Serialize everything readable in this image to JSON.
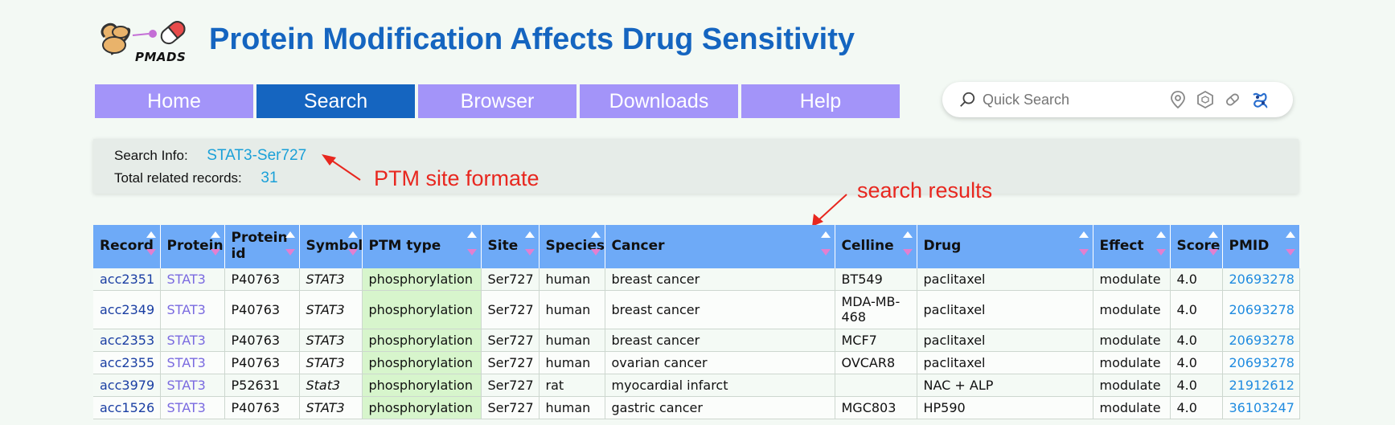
{
  "site": {
    "logo_text": "PMADS",
    "title": "Protein Modification Affects Drug Sensitivity"
  },
  "nav": [
    {
      "label": "Home",
      "active": false
    },
    {
      "label": "Search",
      "active": true
    },
    {
      "label": "Browser",
      "active": false
    },
    {
      "label": "Downloads",
      "active": false
    },
    {
      "label": "Help",
      "active": false
    }
  ],
  "quick_search": {
    "placeholder": "Quick Search",
    "icons": [
      "search-icon",
      "location-pin-icon",
      "hexagon-icon",
      "pill-icon",
      "protein-structure-icon"
    ]
  },
  "search_info": {
    "label": "Search Info:",
    "value": "STAT3-Ser727",
    "total_label": "Total related records:",
    "total_value": "31"
  },
  "annotations": {
    "ptm": "PTM site formate",
    "results": "search results"
  },
  "table": {
    "columns": [
      "Record",
      "Protein",
      "Protein id",
      "Symbol",
      "PTM type",
      "Site",
      "Species",
      "Cancer",
      "Celline",
      "Drug",
      "Effect",
      "Score",
      "PMID"
    ],
    "rows": [
      [
        "acc2351",
        "STAT3",
        "P40763",
        "STAT3",
        "phosphorylation",
        "Ser727",
        "human",
        "breast cancer",
        "BT549",
        "paclitaxel",
        "modulate",
        "4.0",
        "20693278"
      ],
      [
        "acc2349",
        "STAT3",
        "P40763",
        "STAT3",
        "phosphorylation",
        "Ser727",
        "human",
        "breast cancer",
        "MDA-MB-468",
        "paclitaxel",
        "modulate",
        "4.0",
        "20693278"
      ],
      [
        "acc2353",
        "STAT3",
        "P40763",
        "STAT3",
        "phosphorylation",
        "Ser727",
        "human",
        "breast cancer",
        "MCF7",
        "paclitaxel",
        "modulate",
        "4.0",
        "20693278"
      ],
      [
        "acc2355",
        "STAT3",
        "P40763",
        "STAT3",
        "phosphorylation",
        "Ser727",
        "human",
        "ovarian cancer",
        "OVCAR8",
        "paclitaxel",
        "modulate",
        "4.0",
        "20693278"
      ],
      [
        "acc3979",
        "STAT3",
        "P52631",
        "Stat3",
        "phosphorylation",
        "Ser727",
        "rat",
        "myocardial infarct",
        "",
        "NAC + ALP",
        "modulate",
        "4.0",
        "21912612"
      ],
      [
        "acc1526",
        "STAT3",
        "P40763",
        "STAT3",
        "phosphorylation",
        "Ser727",
        "human",
        "gastric cancer",
        "MGC803",
        "HP590",
        "modulate",
        "4.0",
        "36103247"
      ]
    ]
  },
  "colors": {
    "brand": "#1565c0",
    "nav": "#a394f9",
    "header": "#6eaaf7",
    "ptm_cell": "#d7f5cc",
    "annotation": "#e8271f"
  }
}
